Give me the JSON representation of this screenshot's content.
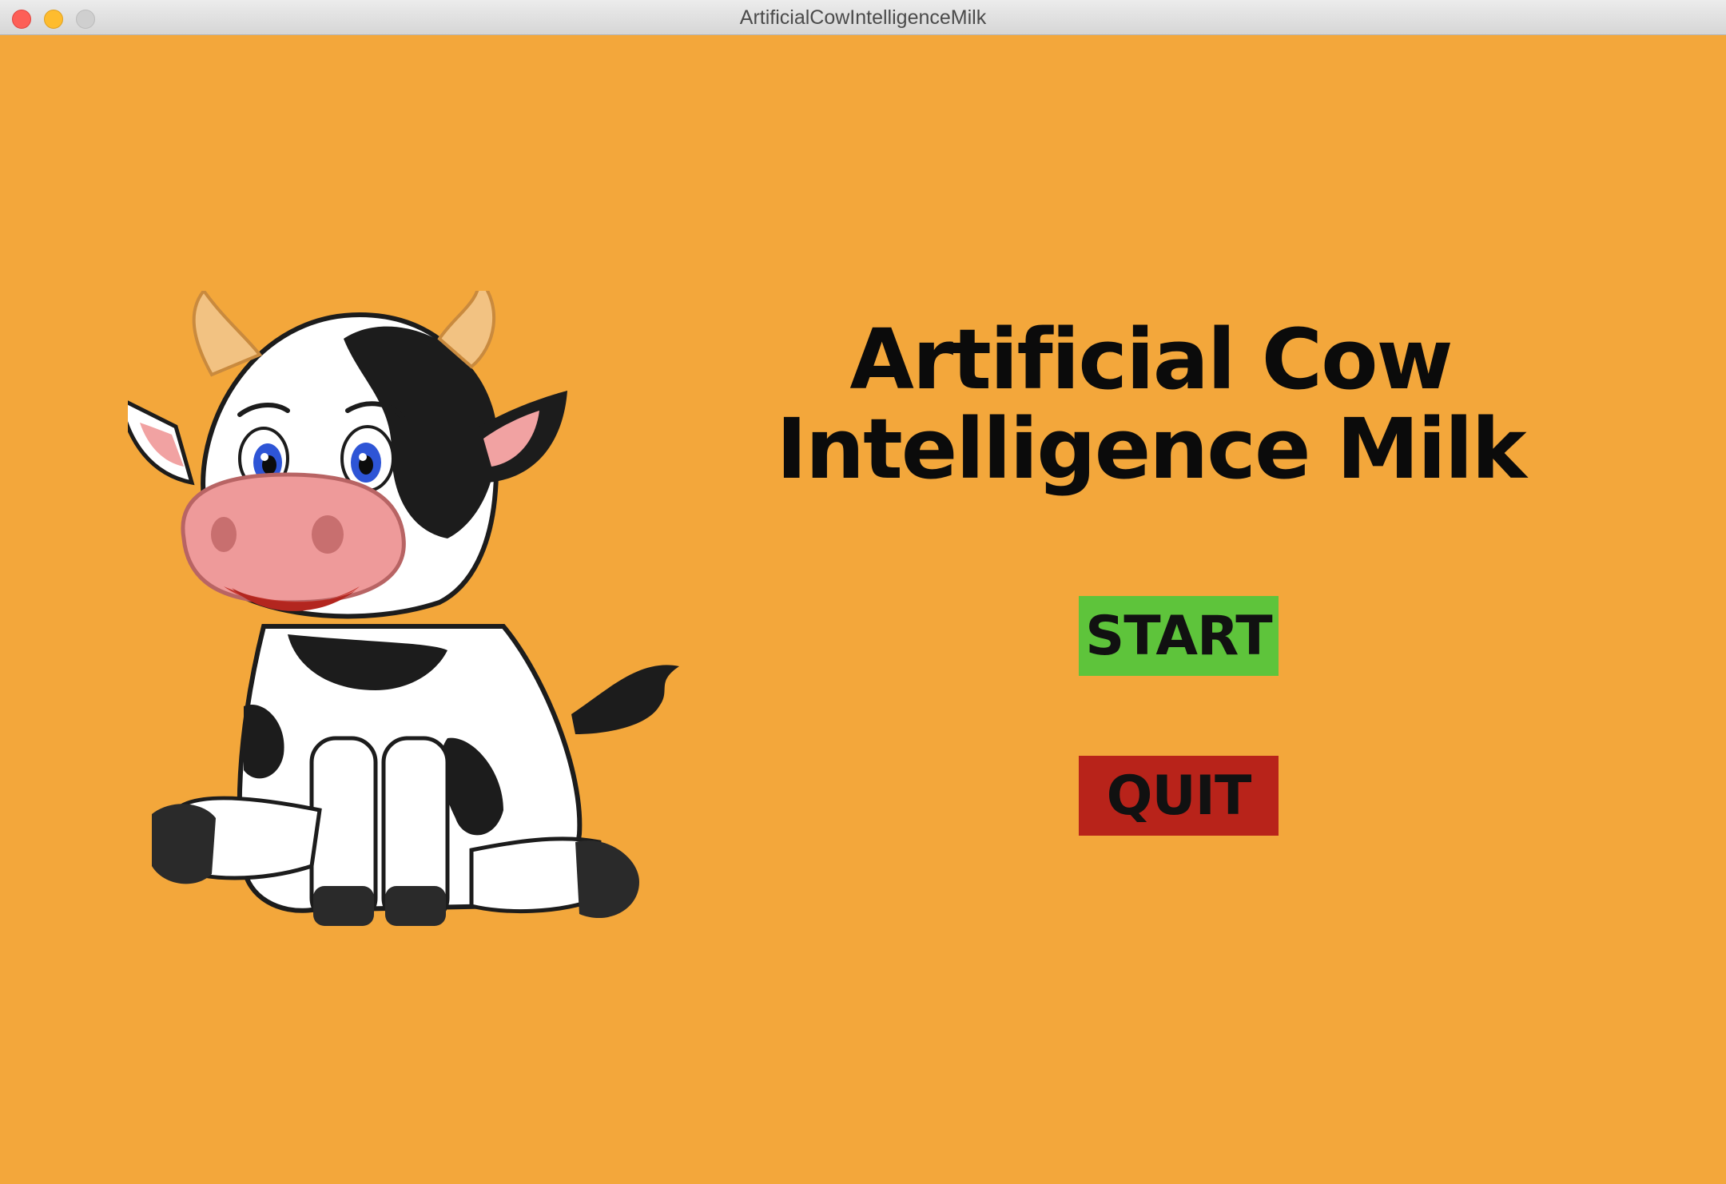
{
  "window": {
    "title": "ArtificialCowIntelligenceMilk"
  },
  "game": {
    "title_line1": "Artificial Cow",
    "title_line2": "Intelligence Milk",
    "start_label": "START",
    "quit_label": "QUIT"
  },
  "colors": {
    "background": "#f3a73b",
    "start_button": "#5ec43b",
    "quit_button": "#b8231a",
    "text": "#0b0b0b"
  },
  "icons": {
    "mascot": "cow-illustration"
  }
}
